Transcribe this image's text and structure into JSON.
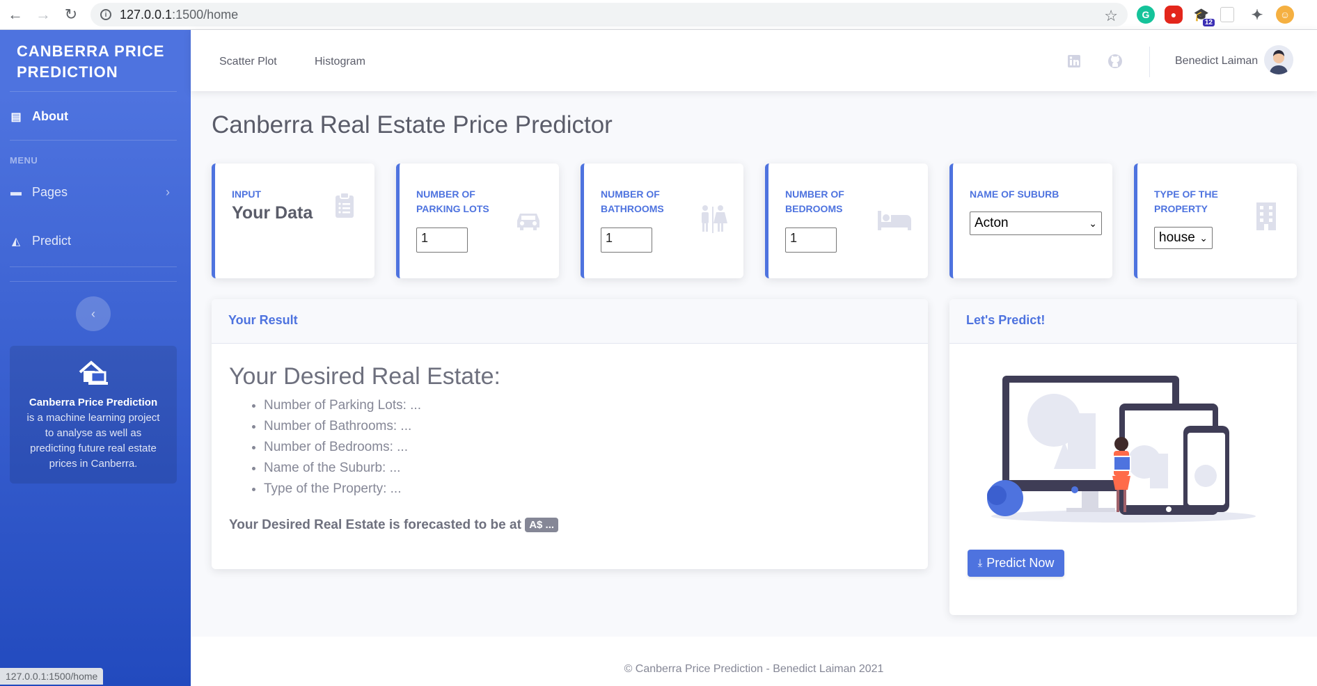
{
  "browser": {
    "url_host": "127.0.0.1",
    "url_path": ":1500/home",
    "status_url": "127.0.0.1:1500/home",
    "ext_badge": "12"
  },
  "sidebar": {
    "brand": "CANBERRA PRICE PREDICTION",
    "about_label": "About",
    "menu_heading": "MENU",
    "items": [
      {
        "label": "Pages",
        "icon": "folder-icon"
      },
      {
        "label": "Predict",
        "icon": "chart-area-icon"
      }
    ],
    "card": {
      "bold": "Canberra Price Prediction",
      "text": " is a machine learning project to analyse as well as predicting future real estate prices in Canberra."
    }
  },
  "topbar": {
    "nav": [
      "Scatter Plot",
      "Histogram"
    ],
    "username": "Benedict Laiman"
  },
  "main": {
    "title": "Canberra Real Estate Price Predictor",
    "cards": {
      "input_label": "INPUT",
      "input_value": "Your Data",
      "parking_label": "NUMBER OF PARKING LOTS",
      "parking_value": "1",
      "bathrooms_label": "NUMBER OF BATHROOMS",
      "bathrooms_value": "1",
      "bedrooms_label": "NUMBER OF BEDROOMS",
      "bedrooms_value": "1",
      "suburb_label": "NAME OF SUBURB",
      "suburb_value": "Acton",
      "property_label": "TYPE OF THE PROPERTY",
      "property_value": "house"
    },
    "result": {
      "header": "Your Result",
      "title": "Your Desired Real Estate:",
      "items": [
        "Number of Parking Lots: ...",
        "Number of Bathrooms: ...",
        "Number of Bedrooms: ...",
        "Name of the Suburb: ...",
        "Type of the Property: ..."
      ],
      "forecast_text": "Your Desired Real Estate is forecasted to be at ",
      "forecast_badge": "A$ ..."
    },
    "predict": {
      "header": "Let's Predict!",
      "button": "Predict Now"
    }
  },
  "footer": {
    "text": "© Canberra Price Prediction - Benedict Laiman 2021"
  },
  "colors": {
    "primary": "#4e73df",
    "sidebar_end": "#224abe",
    "text_gray": "#5a5c69",
    "badge_gray": "#858796"
  }
}
